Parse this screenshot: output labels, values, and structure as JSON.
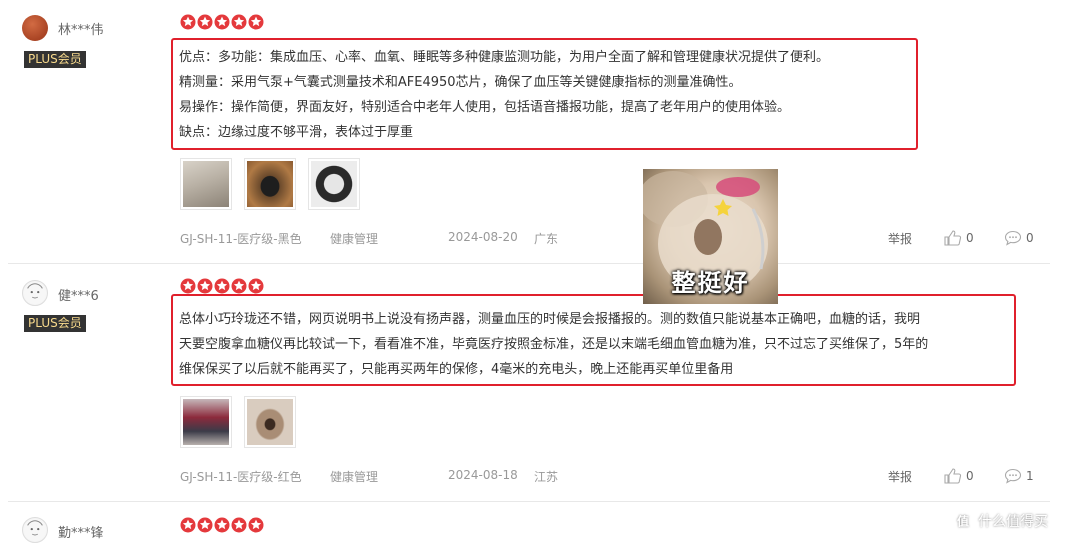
{
  "colors": {
    "star": "#e4393c",
    "highlight_border": "#e0202c",
    "badge_bg": "#333333",
    "badge_text": "#f7d98c"
  },
  "reviews": [
    {
      "username": "林***伟",
      "badge": "PLUS会员",
      "rating": 5,
      "content": [
        "优点：多功能：集成血压、心率、血氧、睡眠等多种健康监测功能，为用户全面了解和管理健康状况提供了便利。",
        "精测量：采用气泵+气囊式测量技术和AFE4950芯片，确保了血压等关键健康指标的测量准确性。",
        "易操作：操作简便，界面友好，特别适合中老年人使用，包括语音播报功能，提高了老年用户的使用体验。",
        "缺点：边缘过度不够平滑，表体过于厚重"
      ],
      "variant": "GJ-SH-11-医疗级-黑色",
      "category": "健康管理",
      "date": "2024-08-20",
      "location": "广东",
      "report": "举报",
      "likes": "0",
      "comments": "0"
    },
    {
      "username": "健***6",
      "badge": "PLUS会员",
      "rating": 5,
      "content": [
        "总体小巧玲珑还不错，网页说明书上说没有扬声器，测量血压的时候是会报播报的。测的数值只能说基本正确吧，血糖的话，我明",
        "天要空腹拿血糖仪再比较试一下，看看准不准，毕竟医疗按照金标准，还是以末端毛细血管血糖为准，只不过忘了买维保了，5年的",
        "维保保买了以后就不能再买了，只能再买两年的保修，4毫米的充电头，晚上还能再买单位里备用"
      ],
      "variant": "GJ-SH-11-医疗级-红色",
      "category": "健康管理",
      "date": "2024-08-18",
      "location": "江苏",
      "report": "举报",
      "likes": "0",
      "comments": "1"
    },
    {
      "username": "勤***锋",
      "rating": 5
    }
  ],
  "meme_caption": "整挺好",
  "watermark": "什么值得买"
}
